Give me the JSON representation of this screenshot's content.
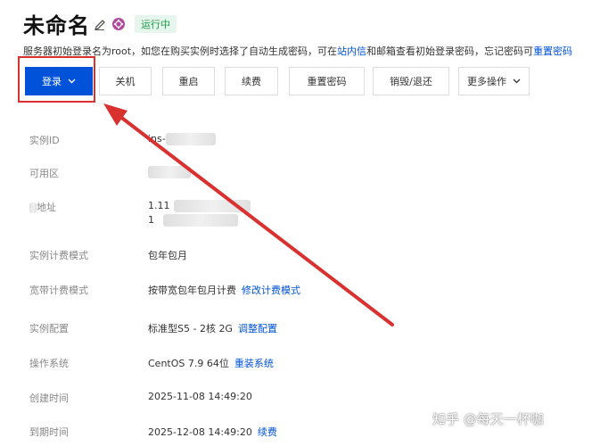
{
  "header": {
    "title": "未命名",
    "status": "运行中"
  },
  "notice": {
    "text_1": "服务器初始登录名为root，如您在购买实例时选择了自动生成密码，可在",
    "link_1": "站内信",
    "text_2": "和邮箱查看初始登录密码，忘记密码可",
    "link_2": "重置密码"
  },
  "toolbar": {
    "login": "登录",
    "shutdown": "关机",
    "restart": "重启",
    "renew": "续费",
    "reset_password": "重置密码",
    "destroy": "销毁/退还",
    "more": "更多操作"
  },
  "info": {
    "instance_id": {
      "label": "实例ID",
      "value": "ins-"
    },
    "zone": {
      "label": "可用区",
      "value": ""
    },
    "ip": {
      "label": "地址",
      "value_1": "1.11",
      "value_2": "1"
    },
    "billing_mode": {
      "label": "实例计费模式",
      "value": "包年包月"
    },
    "bandwidth_mode": {
      "label": "宽带计费模式",
      "value": "按带宽包年包月计费",
      "link": "修改计费模式"
    },
    "config": {
      "label": "实例配置",
      "value": "标准型S5 - 2核 2G",
      "link": "调整配置"
    },
    "os": {
      "label": "操作系统",
      "value": "CentOS 7.9 64位",
      "link": "重装系统"
    },
    "created": {
      "label": "创建时间",
      "value": "2025-11-08 14:49:20"
    },
    "expires": {
      "label": "到期时间",
      "value": "2025-12-08 14:49:20",
      "link": "续费"
    }
  },
  "watermark": "知乎 @每天一杯咖",
  "icons": {
    "edit": "pencil-icon",
    "region": "region-flower-icon",
    "chevron": "chevron-down-icon",
    "annotation": "red-arrow"
  },
  "colors": {
    "primary": "#0052d9",
    "status_bg": "#e7f6ec",
    "status_text": "#1e9c4c",
    "annotation": "#d9312f"
  }
}
